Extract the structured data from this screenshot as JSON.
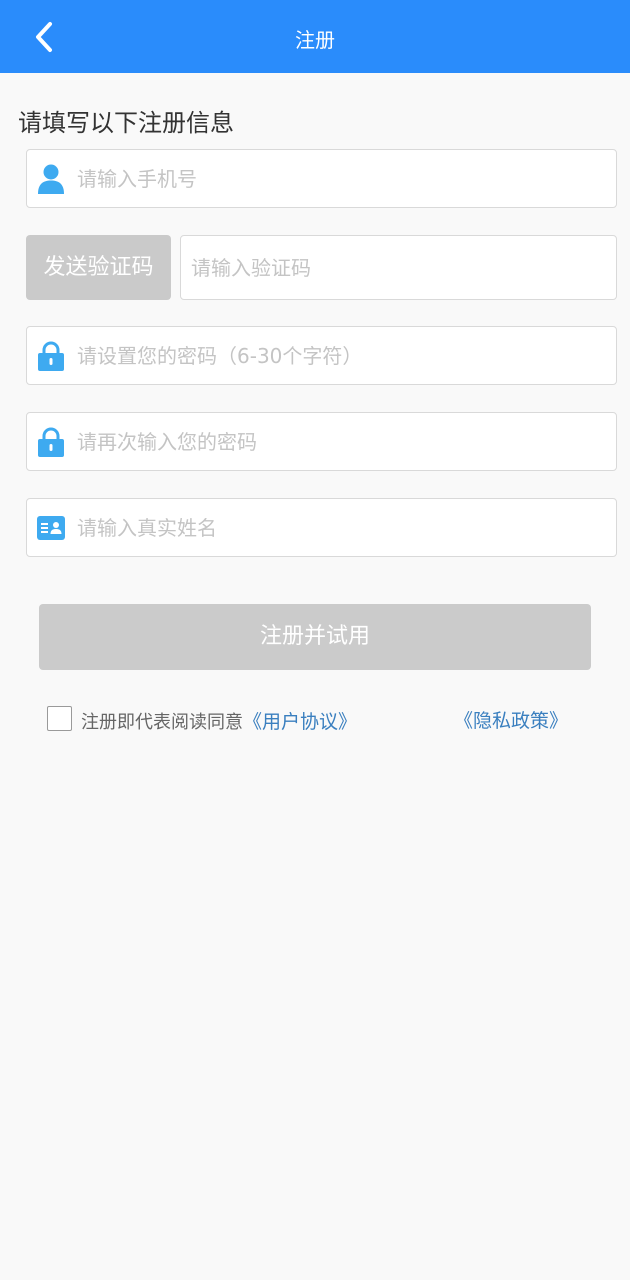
{
  "header": {
    "title": "注册",
    "back_icon": "chevron-left-icon"
  },
  "form": {
    "heading": "请填写以下注册信息",
    "phone_placeholder": "请输入手机号",
    "send_code_label": "发送验证码",
    "code_placeholder": "请输入验证码",
    "password_placeholder": "请设置您的密码（6-30个字符）",
    "confirm_password_placeholder": "请再次输入您的密码",
    "real_name_placeholder": "请输入真实姓名",
    "submit_label": "注册并试用"
  },
  "agreement": {
    "text": "注册即代表阅读同意",
    "user_agreement_link": "《用户协议》",
    "privacy_policy_link": "《隐私政策》",
    "checked": false
  },
  "colors": {
    "header_bg": "#2a8cfb",
    "icon_blue": "#3eaaf0",
    "link": "#3a7fbf",
    "disabled_button": "#cbcbcb"
  }
}
